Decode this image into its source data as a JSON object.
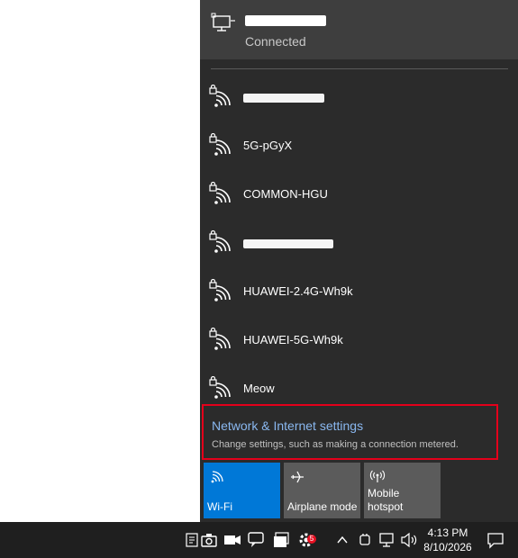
{
  "connected_network": {
    "status": "Connected",
    "icon": "ethernet-monitor-icon"
  },
  "wifi_networks": [
    {
      "ssid": "",
      "redacted": true
    },
    {
      "ssid": "5G-pGyX",
      "redacted": false
    },
    {
      "ssid": "COMMON-HGU",
      "redacted": false
    },
    {
      "ssid": "",
      "redacted": true
    },
    {
      "ssid": "HUAWEI-2.4G-Wh9k",
      "redacted": false
    },
    {
      "ssid": "HUAWEI-5G-Wh9k",
      "redacted": false
    },
    {
      "ssid": "Meow",
      "redacted": false
    }
  ],
  "settings_link": {
    "title": "Network & Internet settings",
    "subtitle": "Change settings, such as making a connection metered."
  },
  "quick_actions": [
    {
      "label": "Wi-Fi",
      "active": true,
      "icon": "wifi-icon"
    },
    {
      "label": "Airplane mode",
      "active": false,
      "icon": "airplane-icon"
    },
    {
      "label": "Mobile\nhotspot",
      "active": false,
      "icon": "hotspot-icon"
    }
  ],
  "taskbar": {
    "time": "4:13 PM",
    "date": "8/10/2026",
    "notification_badge": "5"
  },
  "colors": {
    "flyout_bg": "#2b2b2b",
    "connected_bg": "#3e3e3e",
    "accent": "#0078d7",
    "link": "#8ab8f0",
    "highlight_border": "#e4001b"
  }
}
